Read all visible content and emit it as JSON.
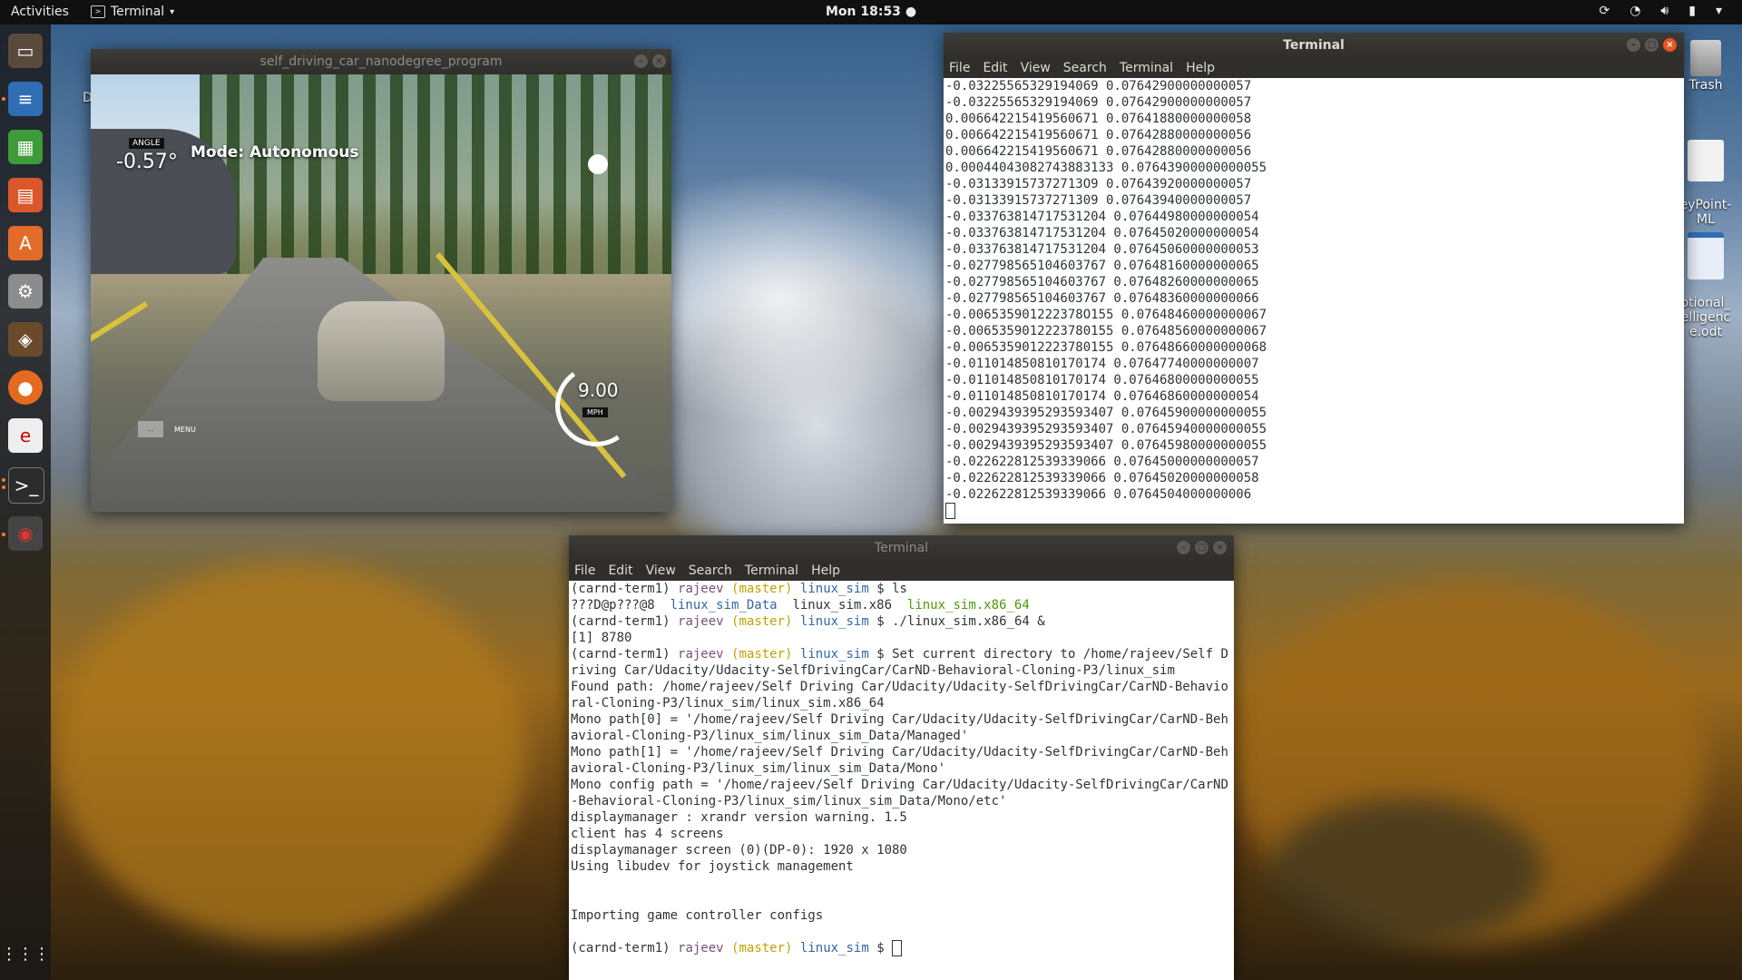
{
  "topbar": {
    "activities": "Activities",
    "app_name": "Terminal",
    "clock": "Mon 18:53"
  },
  "desktop_icons": [
    {
      "label": "Trash",
      "icon": "trash-icon"
    },
    {
      "label": "eyPoint-\nML",
      "icon": "document-icon"
    },
    {
      "label": "otional_\nelligenc\ne.odt",
      "icon": "odt-document-icon"
    }
  ],
  "partial_desktop_label": "D",
  "simulator": {
    "title": "self_driving_car_nanodegree_program",
    "angle_tag": "ANGLE",
    "angle": "-0.57°",
    "mode": "Mode: Autonomous",
    "speed": "9.00",
    "speed_unit": "MPH",
    "menu_label": "MENU"
  },
  "terminal1": {
    "title": "Terminal",
    "menu": [
      "File",
      "Edit",
      "View",
      "Search",
      "Terminal",
      "Help"
    ],
    "lines": [
      "-0.03225565329194069 0.07642900000000057",
      "-0.03225565329194069 0.07642900000000057",
      "0.006642215419560671 0.07641880000000058",
      "0.006642215419560671 0.07642880000000056",
      "0.006642215419560671 0.07642880000000056",
      "0.00044043082743883133 0.07643900000000055",
      "-0.031339157372713O9 0.07643920000000057",
      "-0.03133915737271309 0.07643940000000057",
      "-0.033763814717531204 0.07644980000000054",
      "-0.033763814717531204 0.07645020000000054",
      "-0.033763814717531204 0.07645060000000053",
      "-0.027798565104603767 0.07648160000000065",
      "-0.027798565104603767 0.07648260000000065",
      "-0.027798565104603767 0.07648360000000066",
      "-0.006535901222378O155 0.07648460000000067",
      "-0.0065359012223780155 0.07648560000000067",
      "-0.0065359012223780155 0.07648660000000068",
      "-0.011014850810170174 0.07647740000000007",
      "-0.011014850810170174 0.07646800000000055",
      "-0.011014850810170174 0.07646860000000054",
      "-0.0029439395293593407 0.07645900000000055",
      "-0.0029439395293593407 0.07645940000000055",
      "-0.0029439395293593407 0.07645980000000055",
      "-0.022622812539339066 0.07645000000000057",
      "-0.022622812539339066 0.07645020000000058",
      "-0.022622812539339066 0.0764504000000006"
    ]
  },
  "terminal2": {
    "title": "Terminal",
    "menu": [
      "File",
      "Edit",
      "View",
      "Search",
      "Terminal",
      "Help"
    ],
    "prompt": {
      "env": "(carnd-term1)",
      "user": "rajeev",
      "branch": "(master)",
      "dir": "linux_sim",
      "sym": "$"
    },
    "cmd1": "ls",
    "ls_out": {
      "a": "???D@p???@8",
      "b": "linux_sim_Data",
      "c": "linux_sim.x86",
      "d": "linux_sim.x86_64"
    },
    "cmd2": "./linux_sim.x86_64 &",
    "job": "[1] 8780",
    "cmd3": "Set current directory to /home/rajeev/Self Driving Car/Udacity/Udacity-SelfDrivingCar/CarND-Behavioral-Cloning-P3/linux_sim",
    "output": [
      "Found path: /home/rajeev/Self Driving Car/Udacity/Udacity-SelfDrivingCar/CarND-Behavioral-Cloning-P3/linux_sim/linux_sim.x86_64",
      "Mono path[0] = '/home/rajeev/Self Driving Car/Udacity/Udacity-SelfDrivingCar/CarND-Behavioral-Cloning-P3/linux_sim/linux_sim_Data/Managed'",
      "Mono path[1] = '/home/rajeev/Self Driving Car/Udacity/Udacity-SelfDrivingCar/CarND-Behavioral-Cloning-P3/linux_sim/linux_sim_Data/Mono'",
      "Mono config path = '/home/rajeev/Self Driving Car/Udacity/Udacity-SelfDrivingCar/CarND-Behavioral-Cloning-P3/linux_sim/linux_sim_Data/Mono/etc'",
      "displaymanager : xrandr version warning. 1.5",
      "client has 4 screens",
      "displaymanager screen (0)(DP-0): 1920 x 1080",
      "Using libudev for joystick management",
      "",
      "",
      "Importing game controller configs",
      ""
    ]
  }
}
